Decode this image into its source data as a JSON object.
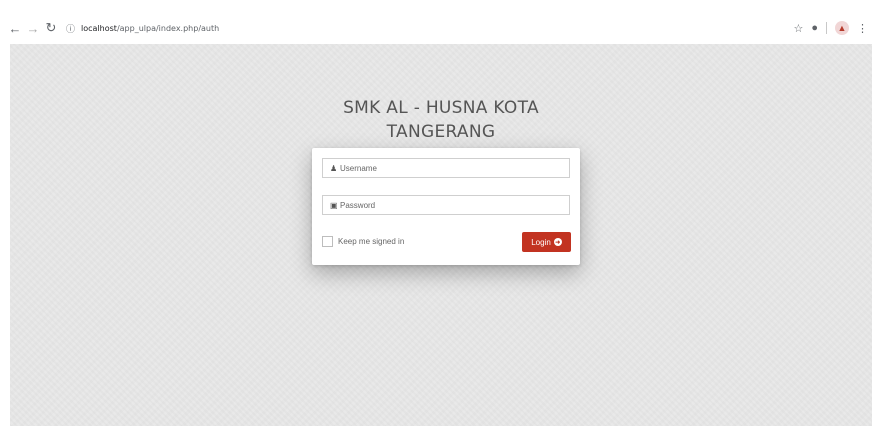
{
  "browser": {
    "address_host": "localhost",
    "address_path": "/app_ulpa/index.php/auth",
    "icons": [
      "back-icon",
      "forward-icon",
      "reload-icon",
      "info-icon",
      "star-icon",
      "extension-icon",
      "profile-icon",
      "menu-icon"
    ]
  },
  "page": {
    "brand_line1": "SMK AL - HUSNA KOTA",
    "brand_line2": "TANGERANG"
  },
  "login_form": {
    "username_placeholder": "Username",
    "password_placeholder": "Password",
    "remember_label": "Keep me signed in",
    "login_label": "Login",
    "accent_color": "#c23321"
  }
}
